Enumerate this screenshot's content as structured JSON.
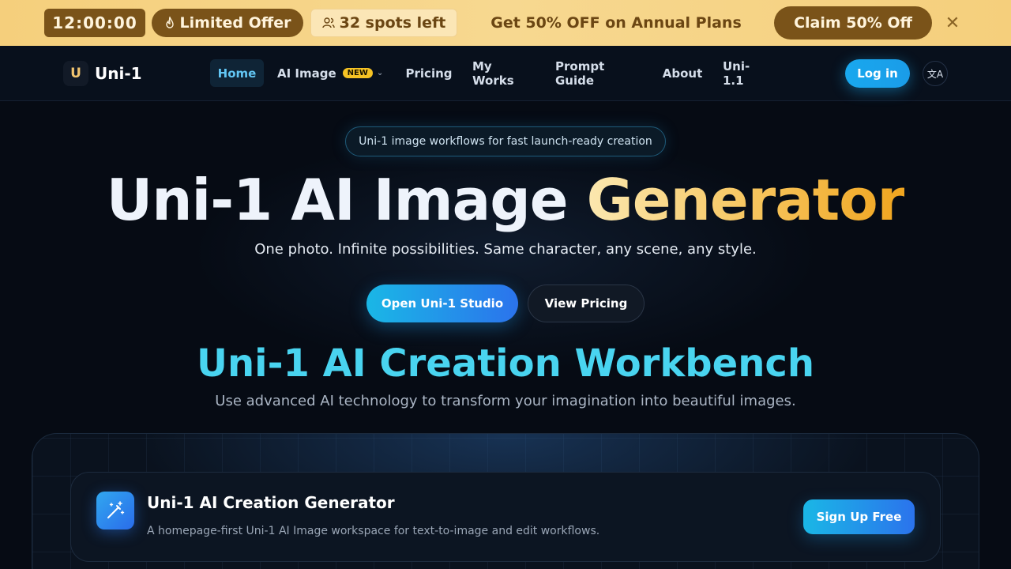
{
  "promo": {
    "timer": "12:00:00",
    "limited_icon": "flame-icon",
    "limited_label": "Limited Offer",
    "spots_icon": "users-icon",
    "spots_label": "32 spots left",
    "message": "Get 50% OFF on Annual Plans",
    "claim_label": "Claim 50% Off",
    "close_icon": "close-icon",
    "close_glyph": "✕"
  },
  "nav": {
    "logo_mark": "U",
    "logo_text": "Uni-1",
    "items": [
      {
        "label": "Home",
        "active": true
      },
      {
        "label": "AI Image",
        "badge": "NEW",
        "has_dropdown": true
      },
      {
        "label": "Pricing"
      },
      {
        "label": "My Works"
      },
      {
        "label": "Prompt Guide"
      },
      {
        "label": "About"
      },
      {
        "label": "Uni-1.1"
      }
    ],
    "login_label": "Log in",
    "language_icon": "translate-icon",
    "language_glyph": "文A"
  },
  "hero": {
    "pill": "Uni-1 image workflows for fast launch-ready creation",
    "title_part1": "Uni-1 AI Image ",
    "title_part2": "Generator",
    "subtitle": "One photo. Infinite possibilities. Same character, any scene, any style.",
    "primary_cta": "Open Uni-1 Studio",
    "secondary_cta": "View Pricing"
  },
  "workbench": {
    "title": "Uni-1 AI Creation Workbench",
    "subtitle": "Use advanced AI technology to transform your imagination into beautiful images.",
    "card": {
      "icon": "magic-wand-icon",
      "title": "Uni-1 AI Creation Generator",
      "description": "A homepage-first Uni-1 AI Image workspace for text-to-image and edit workflows.",
      "cta": "Sign Up Free"
    }
  },
  "colors": {
    "promo_bg": "#f5cf7c",
    "promo_dark": "#7a5319",
    "accent_blue": "#19a8ee",
    "accent_cyan": "#49d4f0",
    "accent_gold": "#f0a51f",
    "page_bg": "#060b14"
  }
}
